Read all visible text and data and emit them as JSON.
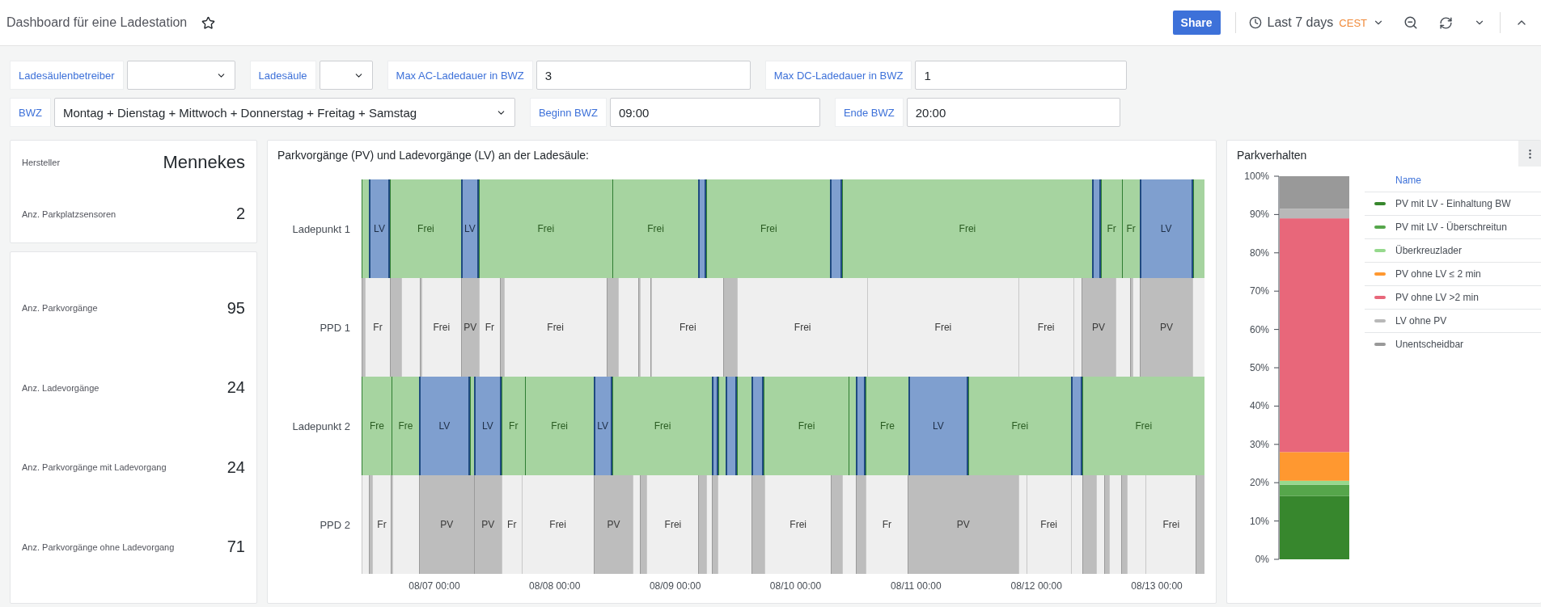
{
  "header": {
    "title": "Dashboard für eine Ladestation",
    "starred": false,
    "share": "Share",
    "time_range": "Last 7 days",
    "timezone": "CEST"
  },
  "variables": [
    [
      {
        "label": "Ladesäulenbetreiber",
        "kind": "select"
      },
      {
        "label": "Ladesäule",
        "kind": "select"
      },
      {
        "label": "Max AC-Ladedauer in BWZ",
        "kind": "input",
        "value": "3"
      },
      {
        "label": "Max DC-Ladedauer in BWZ",
        "kind": "input",
        "value": "1"
      }
    ],
    [
      {
        "label": "BWZ",
        "kind": "select",
        "value": "Montag + Dienstag + Mittwoch + Donnerstag + Freitag + Samstag"
      },
      {
        "label": "Beginn BWZ",
        "kind": "input",
        "value": "09:00"
      },
      {
        "label": "Ende BWZ",
        "kind": "input",
        "value": "20:00"
      }
    ]
  ],
  "stat_panels": [
    [
      {
        "label": "Hersteller",
        "value": "Mennekes"
      },
      {
        "label": "Anz. Parkplatzsensoren",
        "value": "2"
      }
    ],
    [
      {
        "label": "Anz. Parkvorgänge",
        "value": "95"
      },
      {
        "label": "Anz. Ladevorgänge",
        "value": "24"
      },
      {
        "label": "Anz. Parkvorgänge mit Ladevorgang",
        "value": "24"
      },
      {
        "label": "Anz. Parkvorgänge ohne Ladevorgang",
        "value": "71"
      }
    ]
  ],
  "timeline": {
    "title": "Parkvorgänge (PV) und Ladevorgänge (LV) an der Ladesäule:",
    "ticks": [
      "08/07 00:00",
      "08/08 00:00",
      "08/09 00:00",
      "08/10 00:00",
      "08/11 00:00",
      "08/12 00:00",
      "08/13 00:00"
    ],
    "rows": [
      {
        "name": "Ladepunkt 1",
        "kind": "ladepunkt",
        "segments": [
          {
            "kind": "frei"
          },
          {
            "kind": "lv",
            "label": "LV"
          },
          {
            "kind": "frei",
            "label": "Frei"
          },
          {
            "kind": "lv",
            "label": "LV"
          },
          {
            "kind": "frei",
            "label": "Frei"
          },
          {
            "kind": "frei",
            "label": "Frei"
          },
          {
            "kind": "lv"
          },
          {
            "kind": "frei",
            "label": "Frei"
          },
          {
            "kind": "lv"
          },
          {
            "kind": "frei",
            "label": "Frei"
          },
          {
            "kind": "lv"
          },
          {
            "kind": "frei",
            "label": "Fr"
          },
          {
            "kind": "frei",
            "label": "Fr"
          },
          {
            "kind": "lv",
            "label": "LV"
          },
          {
            "kind": "frei"
          }
        ]
      },
      {
        "name": "PPD 1",
        "kind": "ppd",
        "segments": [
          {
            "kind": "pv"
          },
          {
            "kind": "frei",
            "label": "Fr"
          },
          {
            "kind": "pv"
          },
          {
            "kind": "frei"
          },
          {
            "kind": "pv"
          },
          {
            "kind": "frei",
            "label": "Frei"
          },
          {
            "kind": "pv",
            "label": "PV"
          },
          {
            "kind": "frei",
            "label": "Fr"
          },
          {
            "kind": "pv"
          },
          {
            "kind": "frei",
            "label": "Frei"
          },
          {
            "kind": "pv"
          },
          {
            "kind": "frei"
          },
          {
            "kind": "pv"
          },
          {
            "kind": "frei"
          },
          {
            "kind": "pv"
          },
          {
            "kind": "frei",
            "label": "Frei"
          },
          {
            "kind": "pv"
          },
          {
            "kind": "frei",
            "label": "Frei"
          },
          {
            "kind": "frei",
            "label": "Frei"
          },
          {
            "kind": "frei",
            "label": "Frei"
          },
          {
            "kind": "frei"
          },
          {
            "kind": "pv",
            "label": "PV"
          },
          {
            "kind": "frei"
          },
          {
            "kind": "pv"
          },
          {
            "kind": "frei"
          },
          {
            "kind": "pv",
            "label": "PV"
          },
          {
            "kind": "frei"
          }
        ]
      },
      {
        "name": "Ladepunkt 2",
        "kind": "ladepunkt",
        "segments": [
          {
            "kind": "frei",
            "label": "Fre"
          },
          {
            "kind": "frei",
            "label": "Fre"
          },
          {
            "kind": "lv",
            "label": "LV"
          },
          {
            "kind": "frei"
          },
          {
            "kind": "lv",
            "label": "LV"
          },
          {
            "kind": "frei",
            "label": "Fr"
          },
          {
            "kind": "frei",
            "label": "Frei"
          },
          {
            "kind": "lv",
            "label": "LV"
          },
          {
            "kind": "frei",
            "label": "Frei"
          },
          {
            "kind": "lv"
          },
          {
            "kind": "frei"
          },
          {
            "kind": "lv"
          },
          {
            "kind": "frei"
          },
          {
            "kind": "lv"
          },
          {
            "kind": "frei",
            "label": "Frei"
          },
          {
            "kind": "frei"
          },
          {
            "kind": "lv"
          },
          {
            "kind": "frei",
            "label": "Fre"
          },
          {
            "kind": "lv",
            "label": "LV"
          },
          {
            "kind": "frei",
            "label": "Frei"
          },
          {
            "kind": "lv"
          },
          {
            "kind": "frei",
            "label": "Frei"
          }
        ]
      },
      {
        "name": "PPD 2",
        "kind": "ppd",
        "segments": [
          {
            "kind": "frei"
          },
          {
            "kind": "pv"
          },
          {
            "kind": "frei",
            "label": "Fr"
          },
          {
            "kind": "pv"
          },
          {
            "kind": "frei"
          },
          {
            "kind": "pv",
            "label": "PV"
          },
          {
            "kind": "pv",
            "label": "PV"
          },
          {
            "kind": "frei",
            "label": "Fr"
          },
          {
            "kind": "frei",
            "label": "Frei"
          },
          {
            "kind": "pv",
            "label": "PV"
          },
          {
            "kind": "frei"
          },
          {
            "kind": "pv"
          },
          {
            "kind": "frei",
            "label": "Frei"
          },
          {
            "kind": "pv"
          },
          {
            "kind": "frei"
          },
          {
            "kind": "pv"
          },
          {
            "kind": "frei"
          },
          {
            "kind": "pv"
          },
          {
            "kind": "frei",
            "label": "Frei"
          },
          {
            "kind": "pv"
          },
          {
            "kind": "frei"
          },
          {
            "kind": "pv"
          },
          {
            "kind": "frei",
            "label": "Fr"
          },
          {
            "kind": "pv",
            "label": "PV"
          },
          {
            "kind": "frei"
          },
          {
            "kind": "frei",
            "label": "Frei"
          },
          {
            "kind": "frei"
          },
          {
            "kind": "pv"
          },
          {
            "kind": "frei"
          },
          {
            "kind": "pv"
          },
          {
            "kind": "frei"
          },
          {
            "kind": "pv"
          },
          {
            "kind": "frei"
          },
          {
            "kind": "frei",
            "label": "Frei"
          },
          {
            "kind": "pv"
          }
        ]
      }
    ]
  },
  "parkverhalten": {
    "title": "Parkverhalten",
    "legend_header": "Name",
    "chart_data": {
      "type": "bar",
      "stacked": true,
      "categories": [
        null
      ],
      "ylim": [
        0,
        100
      ],
      "yticks": [
        {
          "value": 0,
          "label": "0%"
        },
        {
          "value": 10,
          "label": "10%"
        },
        {
          "value": 20,
          "label": "20%"
        },
        {
          "value": 30,
          "label": "30%"
        },
        {
          "value": 40,
          "label": "40%"
        },
        {
          "value": 50,
          "label": "50%"
        },
        {
          "value": 60,
          "label": "60%"
        },
        {
          "value": 70,
          "label": "70%"
        },
        {
          "value": 80,
          "label": "80%"
        },
        {
          "value": 90,
          "label": "90%"
        },
        {
          "value": 100,
          "label": "100%"
        }
      ],
      "series": [
        {
          "name": "PV mit LV - Einhaltung BW",
          "color": "#37872d",
          "values": [
            16.5
          ]
        },
        {
          "name": "PV mit LV - Überschreitun",
          "color": "#56a64b",
          "values": [
            3
          ]
        },
        {
          "name": "Überkreuzlader",
          "color": "#96d98d",
          "values": [
            1
          ]
        },
        {
          "name": "PV ohne LV ≤ 2 min",
          "color": "#ff9830",
          "values": [
            7.5
          ]
        },
        {
          "name": "PV ohne LV >2 min",
          "color": "#e8677a",
          "values": [
            61
          ]
        },
        {
          "name": "LV ohne PV",
          "color": "#b8b8b8",
          "values": [
            2.5
          ]
        },
        {
          "name": "Unentscheidbar",
          "color": "#999999",
          "values": [
            8.5
          ]
        }
      ]
    }
  }
}
